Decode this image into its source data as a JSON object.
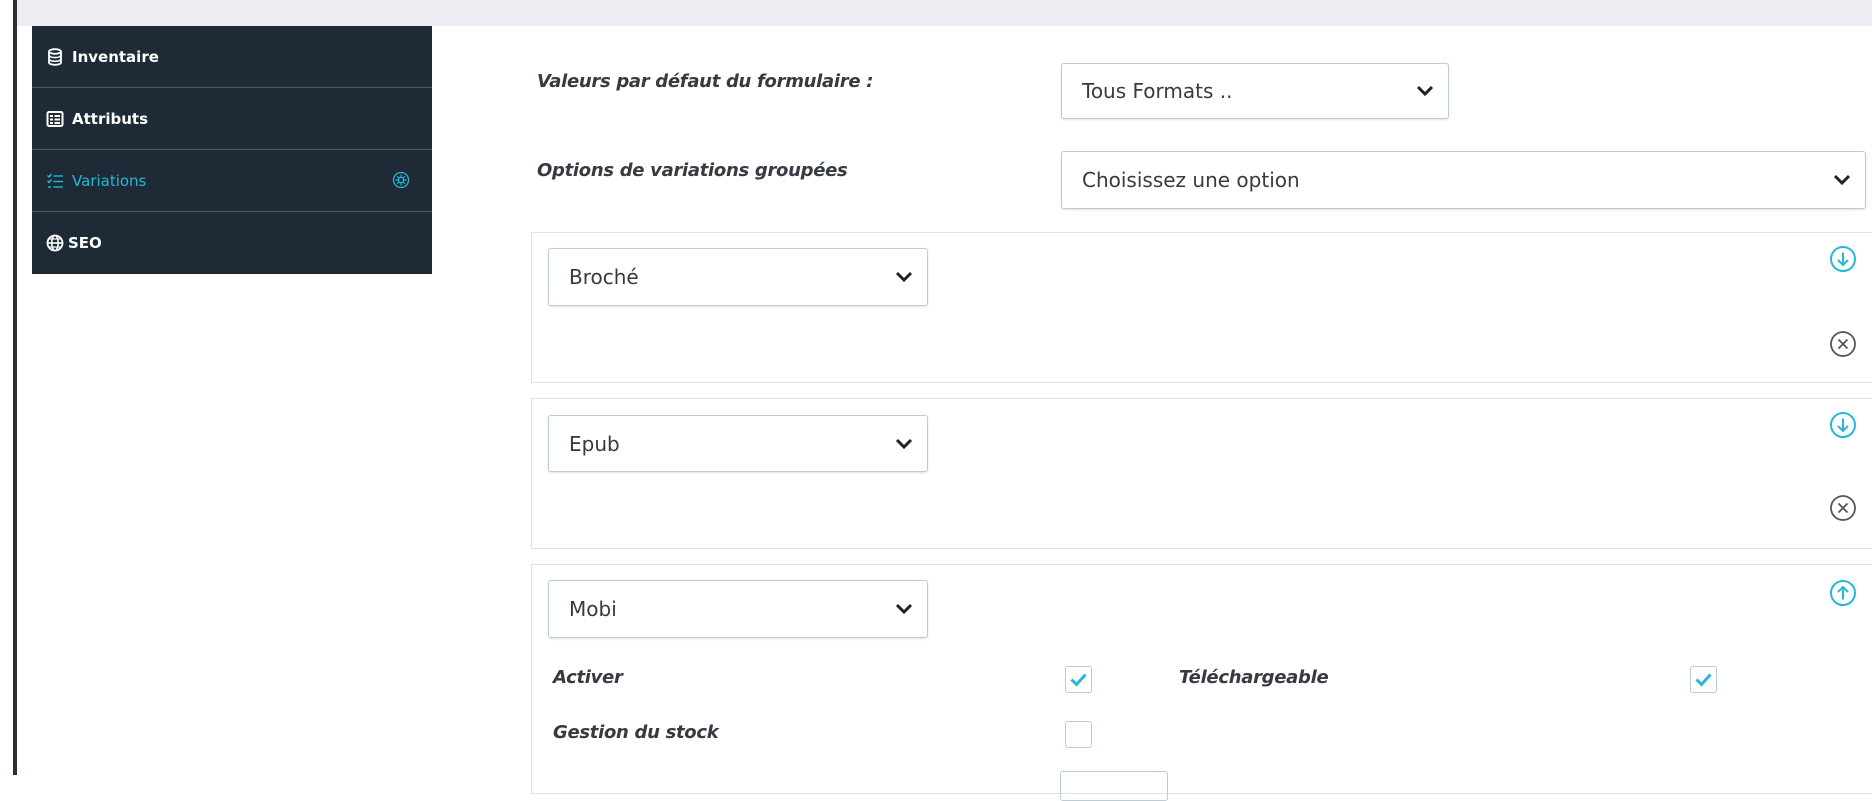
{
  "sidebar": {
    "items": [
      {
        "label": "Inventaire",
        "icon": "database-icon"
      },
      {
        "label": "Attributs",
        "icon": "list-box-icon"
      },
      {
        "label": "Variations",
        "icon": "checklist-icon",
        "status_icon": "settings-circle-icon"
      },
      {
        "label": "SEO",
        "icon": "globe-icon"
      }
    ]
  },
  "form": {
    "defaults_label": "Valeurs par défaut du formulaire :",
    "defaults_value": "Tous Formats ..",
    "grouped_label": "Options de variations groupées",
    "grouped_value": "Choisissez une option"
  },
  "variations": [
    {
      "value": "Broché",
      "expanded": false
    },
    {
      "value": "Epub",
      "expanded": false
    },
    {
      "value": "Mobi",
      "expanded": true
    }
  ],
  "mobi_fields": {
    "activer_label": "Activer",
    "activer_checked": true,
    "telechargeable_label": "Téléchargeable",
    "telechargeable_checked": true,
    "stock_label": "Gestion du stock",
    "stock_checked": false
  },
  "colors": {
    "sidebar_bg": "#1e2a36",
    "accent": "#25b9d7",
    "text": "#363a41"
  }
}
